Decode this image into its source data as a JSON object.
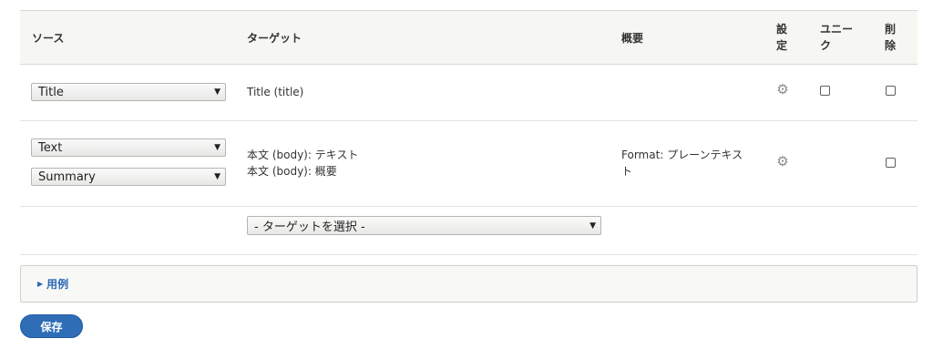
{
  "header": {
    "source": "ソース",
    "target": "ターゲット",
    "summary": "概要",
    "settings": "設定",
    "unique": "ユニーク",
    "delete": "削除"
  },
  "rows": [
    {
      "source_selects": [
        "Title"
      ],
      "target_lines": [
        "Title (title)"
      ],
      "summary": "",
      "has_settings": true,
      "has_unique_checkbox": true,
      "delete_checked": false
    },
    {
      "source_selects": [
        "Text",
        "Summary"
      ],
      "target_lines": [
        "本文 (body): テキスト",
        "本文 (body): 概要"
      ],
      "summary": "Format: プレーンテキスト",
      "has_settings": true,
      "has_unique_checkbox": false,
      "delete_checked": false
    }
  ],
  "new_target_select": "- ターゲットを選択 -",
  "examples_label": "用例",
  "save_label": "保存",
  "icons": {
    "settings": "gear-icon",
    "dropdown": "triangle-down-icon",
    "disclosure": "triangle-right-icon"
  },
  "colors": {
    "link": "#2a6ab3",
    "primary_button": "#2f6db7",
    "header_bg": "#f6f6f2"
  }
}
